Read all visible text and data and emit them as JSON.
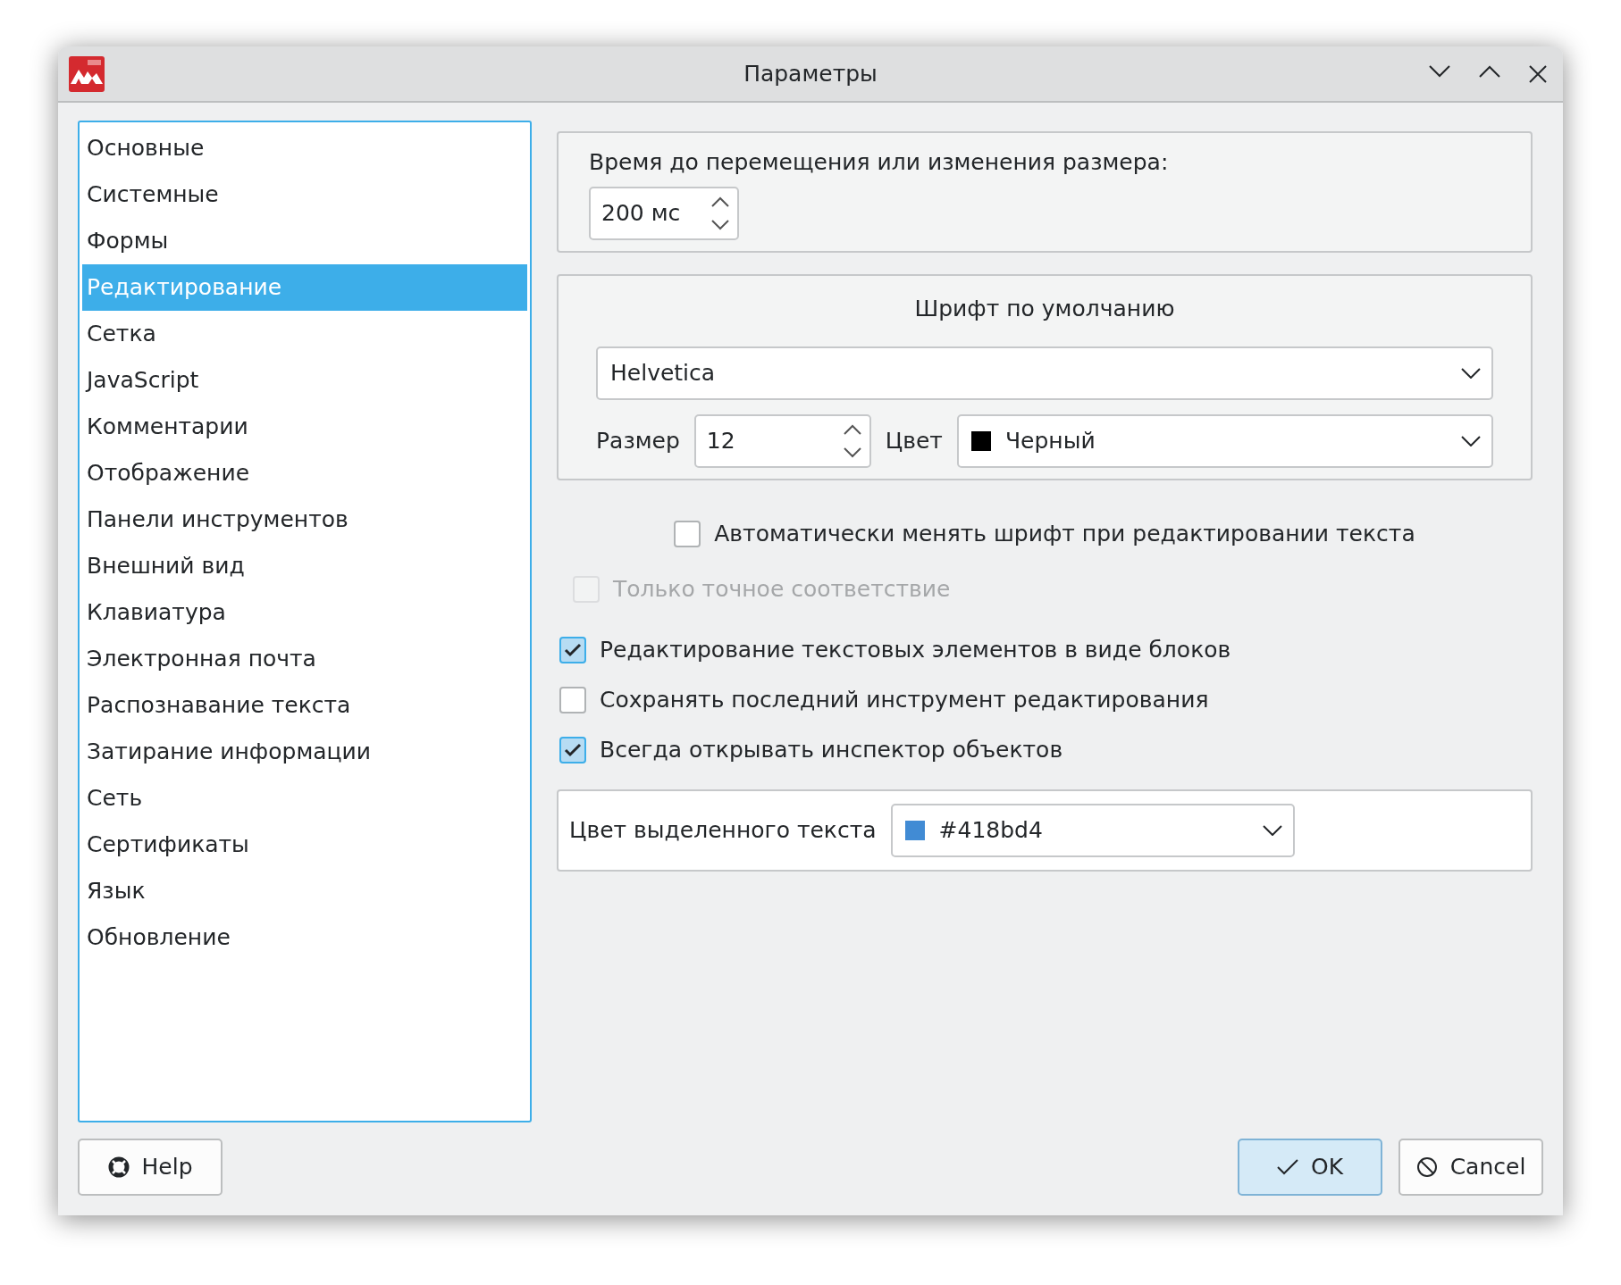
{
  "window": {
    "title": "Параметры"
  },
  "sidebar": {
    "items": [
      {
        "label": "Основные",
        "selected": false
      },
      {
        "label": "Системные",
        "selected": false
      },
      {
        "label": "Формы",
        "selected": false
      },
      {
        "label": "Редактирование",
        "selected": true
      },
      {
        "label": "Сетка",
        "selected": false
      },
      {
        "label": "JavaScript",
        "selected": false
      },
      {
        "label": "Комментарии",
        "selected": false
      },
      {
        "label": "Отображение",
        "selected": false
      },
      {
        "label": "Панели инструментов",
        "selected": false
      },
      {
        "label": "Внешний вид",
        "selected": false
      },
      {
        "label": "Клавиатура",
        "selected": false
      },
      {
        "label": "Электронная почта",
        "selected": false
      },
      {
        "label": "Распознавание текста",
        "selected": false
      },
      {
        "label": "Затирание информации",
        "selected": false
      },
      {
        "label": "Сеть",
        "selected": false
      },
      {
        "label": "Сертификаты",
        "selected": false
      },
      {
        "label": "Язык",
        "selected": false
      },
      {
        "label": "Обновление",
        "selected": false
      }
    ]
  },
  "move_delay": {
    "label": "Время до перемещения или изменения размера:",
    "value": "200 мс"
  },
  "default_font": {
    "title": "Шрифт по умолчанию",
    "family": "Helvetica",
    "size_label": "Размер",
    "size": "12",
    "color_label": "Цвет",
    "color_name": "Черный"
  },
  "options": [
    {
      "kind": "centered",
      "label": "Автоматически менять шрифт при редактировании текста",
      "checked": false,
      "disabled": false
    },
    {
      "kind": "nested",
      "label": "Только точное соответствие",
      "checked": false,
      "disabled": true
    },
    {
      "kind": "plain",
      "label": "Редактирование текстовых элементов в виде блоков",
      "checked": true,
      "disabled": false
    },
    {
      "kind": "plain",
      "label": "Сохранять последний инструмент редактирования",
      "checked": false,
      "disabled": false
    },
    {
      "kind": "plain",
      "label": "Всегда открывать инспектор объектов",
      "checked": true,
      "disabled": false
    }
  ],
  "highlight": {
    "label": "Цвет выделенного текста",
    "value": "#418bd4"
  },
  "buttons": {
    "help": "Help",
    "ok": "OK",
    "cancel": "Cancel"
  }
}
